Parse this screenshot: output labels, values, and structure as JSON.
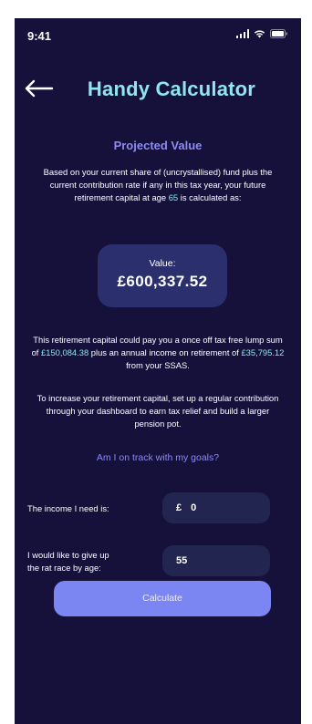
{
  "status_bar": {
    "time": "9:41"
  },
  "header": {
    "title": "Handy Calculator",
    "back_icon": "arrow-left-icon"
  },
  "projection": {
    "title": "Projected Value",
    "intro_before_age": "Based on your current share of (uncrystallised) fund plus the current contribution rate if any in this tax year, your future retirement capital at age ",
    "age": "65",
    "intro_after_age": " is calculated as:",
    "value_label": "Value:",
    "value_amount": "£600,337.52"
  },
  "summary": {
    "part1": "This retirement capital could pay you a once off tax free lump sum of ",
    "lump_sum": "£150,084.38",
    "part2": " plus an annual income on retirement of ",
    "annual_income": "£35,795.12",
    "part3": " from your SSAS."
  },
  "advice": {
    "text": "To increase your retirement capital, set up a regular contribution through your dashboard to earn tax relief and build a larger pension pot."
  },
  "goals": {
    "link_label": "Am I on track with my goals?",
    "income_label": "The income I need is:",
    "income_currency": "£",
    "income_value": "0",
    "retire_label_line1": "I would like to give up",
    "retire_label_line2": "the rat race by age:",
    "retire_age_value": "55"
  },
  "actions": {
    "calculate_label": "Calculate"
  },
  "colors": {
    "background": "#15113a",
    "accent_cyan": "#8fe6ef",
    "accent_purple": "#8d8af4",
    "card": "#2b2f6e",
    "field": "#22254f",
    "button": "#7b86f2"
  }
}
